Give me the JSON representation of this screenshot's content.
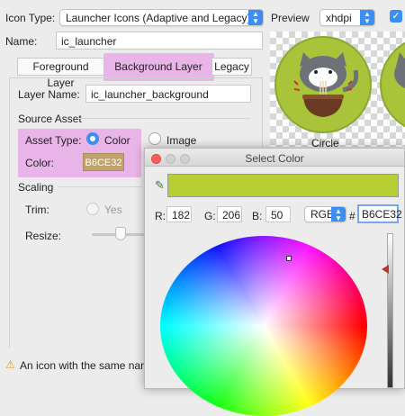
{
  "header": {
    "icon_type_label": "Icon Type:",
    "icon_type_value": "Launcher Icons (Adaptive and Legacy)",
    "name_label": "Name:",
    "name_value": "ic_launcher",
    "preview_label": "Preview",
    "density_value": "xhdpi"
  },
  "tabs": [
    {
      "label": "Foreground Layer"
    },
    {
      "label": "Background Layer"
    },
    {
      "label": "Legacy"
    }
  ],
  "layer": {
    "layer_name_label": "Layer Name:",
    "layer_name_value": "ic_launcher_background",
    "source_asset_label": "Source Asset",
    "asset_type_label": "Asset Type:",
    "option_color": "Color",
    "option_image": "Image",
    "color_label": "Color:",
    "color_value": "B6CE32",
    "scaling_label": "Scaling",
    "trim_label": "Trim:",
    "trim_yes": "Yes",
    "resize_label": "Resize:"
  },
  "preview": {
    "circle_label": "Circle"
  },
  "warning": {
    "text": "An icon with the same name"
  },
  "color_dialog": {
    "title": "Select Color",
    "r_label": "R:",
    "r_value": "182",
    "g_label": "G:",
    "g_value": "206",
    "b_label": "B:",
    "b_value": "50",
    "mode_value": "RGB",
    "hash_label": "#",
    "hex_value": "B6CE32"
  },
  "colors": {
    "selected": "#B6CE32",
    "highlight": "#E9B4E8",
    "accent": "#3B8EF3"
  }
}
